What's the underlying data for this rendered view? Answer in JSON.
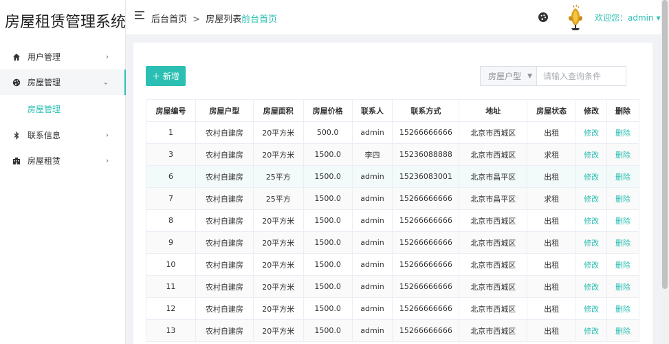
{
  "app": {
    "title": "房屋租赁管理系统"
  },
  "sidebar": {
    "items": [
      {
        "label": "用户管理",
        "icon": "home-icon",
        "chevron": "›"
      },
      {
        "label": "房屋管理",
        "icon": "palette-icon",
        "chevron": "⌄"
      },
      {
        "label": "联系信息",
        "icon": "bluetooth-icon",
        "chevron": "›"
      },
      {
        "label": "房屋租赁",
        "icon": "building-icon",
        "chevron": "›"
      }
    ],
    "submenu": {
      "label": "房屋管理"
    }
  },
  "topbar": {
    "breadcrumb_home": "后台首页",
    "breadcrumb_sep": ">",
    "breadcrumb_current": "房屋列表",
    "front_link": "前台首页",
    "welcome": "欢迎您：admin",
    "dropdown": "▾"
  },
  "toolbar": {
    "add_label": "＋ 新增",
    "search_select": "房屋户型",
    "search_placeholder": "请输入查询条件"
  },
  "table": {
    "headers": [
      "房屋编号",
      "房屋户型",
      "房屋面积",
      "房屋价格",
      "联系人",
      "联系方式",
      "地址",
      "房屋状态",
      "修改",
      "删除"
    ],
    "rows": [
      [
        "1",
        "农村自建房",
        "20平方米",
        "500.0",
        "admin",
        "15266666666",
        "北京市西城区",
        "出租",
        "修改",
        "删除"
      ],
      [
        "3",
        "农村自建房",
        "20平方米",
        "1500.0",
        "李四",
        "15236088888",
        "北京市西城区",
        "求租",
        "修改",
        "删除"
      ],
      [
        "6",
        "农村自建房",
        "25平方",
        "1500.0",
        "admin",
        "15236083001",
        "北京市昌平区",
        "出租",
        "修改",
        "删除"
      ],
      [
        "7",
        "农村自建房",
        "25平方",
        "1500.0",
        "admin",
        "15266666666",
        "北京市昌平区",
        "求租",
        "修改",
        "删除"
      ],
      [
        "8",
        "农村自建房",
        "20平方米",
        "1500.0",
        "admin",
        "15266666666",
        "北京市西城区",
        "出租",
        "修改",
        "删除"
      ],
      [
        "9",
        "农村自建房",
        "20平方米",
        "1500.0",
        "admin",
        "15266666666",
        "北京市西城区",
        "出租",
        "修改",
        "删除"
      ],
      [
        "10",
        "农村自建房",
        "20平方米",
        "1500.0",
        "admin",
        "15266666666",
        "北京市西城区",
        "出租",
        "修改",
        "删除"
      ],
      [
        "11",
        "农村自建房",
        "20平方米",
        "1500.0",
        "admin",
        "15266666666",
        "北京市西城区",
        "出租",
        "修改",
        "删除"
      ],
      [
        "12",
        "农村自建房",
        "20平方米",
        "1500.0",
        "admin",
        "15266666666",
        "北京市西城区",
        "出租",
        "修改",
        "删除"
      ],
      [
        "13",
        "农村自建房",
        "20平方米",
        "1500.0",
        "admin",
        "15266666666",
        "北京市西城区",
        "出租",
        "修改",
        "删除"
      ]
    ]
  },
  "colors": {
    "accent": "#2bbfb3"
  }
}
